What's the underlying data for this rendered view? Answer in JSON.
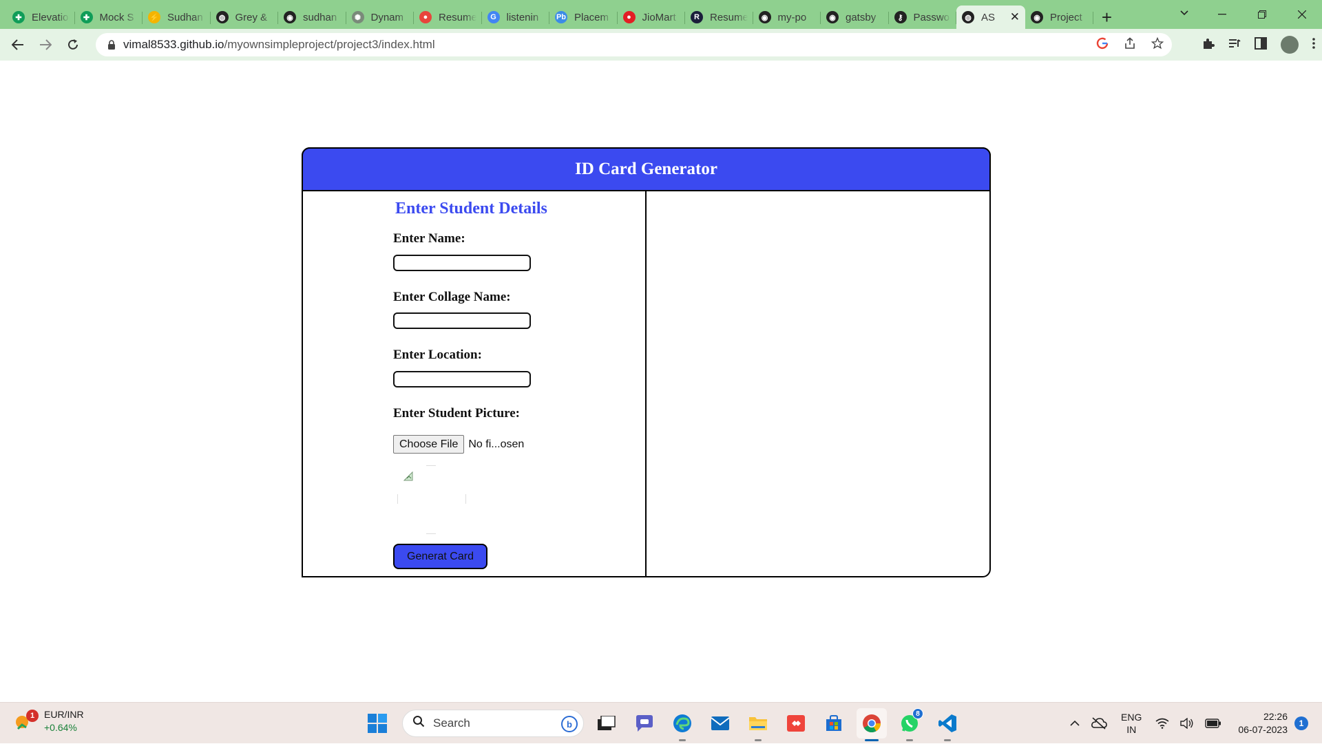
{
  "browser": {
    "tabs": [
      {
        "title": "Elevation",
        "icon": "google-sheets-icon",
        "color": "#0f9d58"
      },
      {
        "title": "Mock S",
        "icon": "google-sheets-icon",
        "color": "#0f9d58"
      },
      {
        "title": "Sudhan",
        "icon": "bolt-icon",
        "color": "#f4b400"
      },
      {
        "title": "Grey &",
        "icon": "globe-icon",
        "color": "#222222"
      },
      {
        "title": "sudhan",
        "icon": "github-icon",
        "color": "#222222"
      },
      {
        "title": "Dynam",
        "icon": "openai-icon",
        "color": "#7a8a7a"
      },
      {
        "title": "Resume",
        "icon": "resume-icon",
        "color": "#e8453c"
      },
      {
        "title": "listenin",
        "icon": "google-icon",
        "color": "#4285f4"
      },
      {
        "title": "Placem",
        "icon": "pb-icon",
        "color": "#3c8ce7"
      },
      {
        "title": "JioMart",
        "icon": "jiomart-icon",
        "color": "#e31e24"
      },
      {
        "title": "Resume",
        "icon": "r-icon",
        "color": "#1b1f3b"
      },
      {
        "title": "my-po",
        "icon": "github-icon",
        "color": "#222222"
      },
      {
        "title": "gatsby",
        "icon": "github-icon",
        "color": "#222222"
      },
      {
        "title": "Passwo",
        "icon": "key-icon",
        "color": "#222222"
      },
      {
        "title": "AS",
        "icon": "globe-icon",
        "color": "#222222",
        "active": true
      },
      {
        "title": "Project",
        "icon": "github-icon",
        "color": "#222222"
      }
    ],
    "url_host": "vimal8533.github.io",
    "url_path": "/myownsimpleproject/project3/index.html"
  },
  "page": {
    "header_title": "ID Card Generator",
    "section_title": "Enter Student Details",
    "name_label": "Enter Name:",
    "collage_label": "Enter Collage Name:",
    "location_label": "Enter Location:",
    "picture_label": "Enter Student Picture:",
    "choose_file_label": "Choose File",
    "file_status": "No fi...osen",
    "generate_button": "Generat Card",
    "accent_color": "#3b4af0"
  },
  "taskbar": {
    "widget_name": "EUR/INR",
    "widget_value": "+0.64%",
    "widget_badge": "1",
    "search_placeholder": "Search",
    "whatsapp_badge": "8",
    "lang_top": "ENG",
    "lang_bottom": "IN",
    "time": "22:26",
    "date": "06-07-2023",
    "notification_count": "1"
  }
}
